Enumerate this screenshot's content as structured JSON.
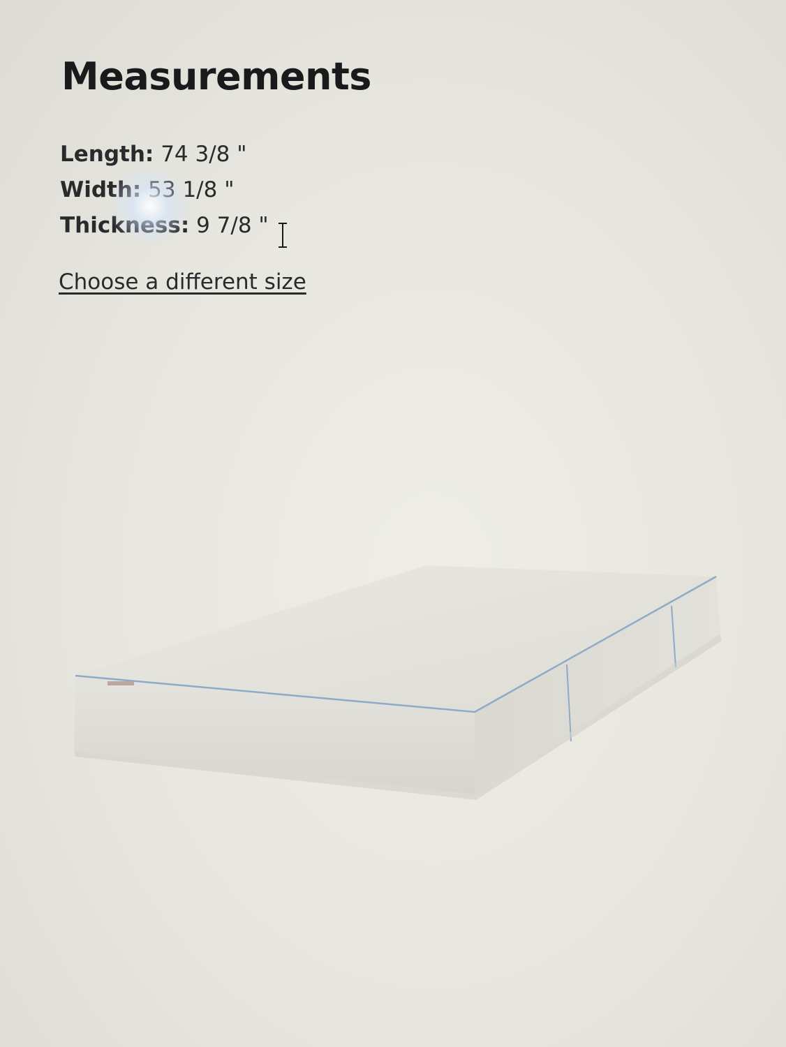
{
  "dialog": {
    "title": "Measurements",
    "close_icon": "close-icon"
  },
  "measurements": [
    {
      "label": "Length:",
      "value": "74 3/8 \""
    },
    {
      "label": "Width:",
      "value": "53 1/8 \""
    },
    {
      "label": "Thickness:",
      "value": "9 7/8 \""
    }
  ],
  "size_link": "Choose a different size",
  "product": {
    "image": "mattress-image",
    "trim_color": "#8fa9c8"
  },
  "cursor": "text-cursor-icon"
}
